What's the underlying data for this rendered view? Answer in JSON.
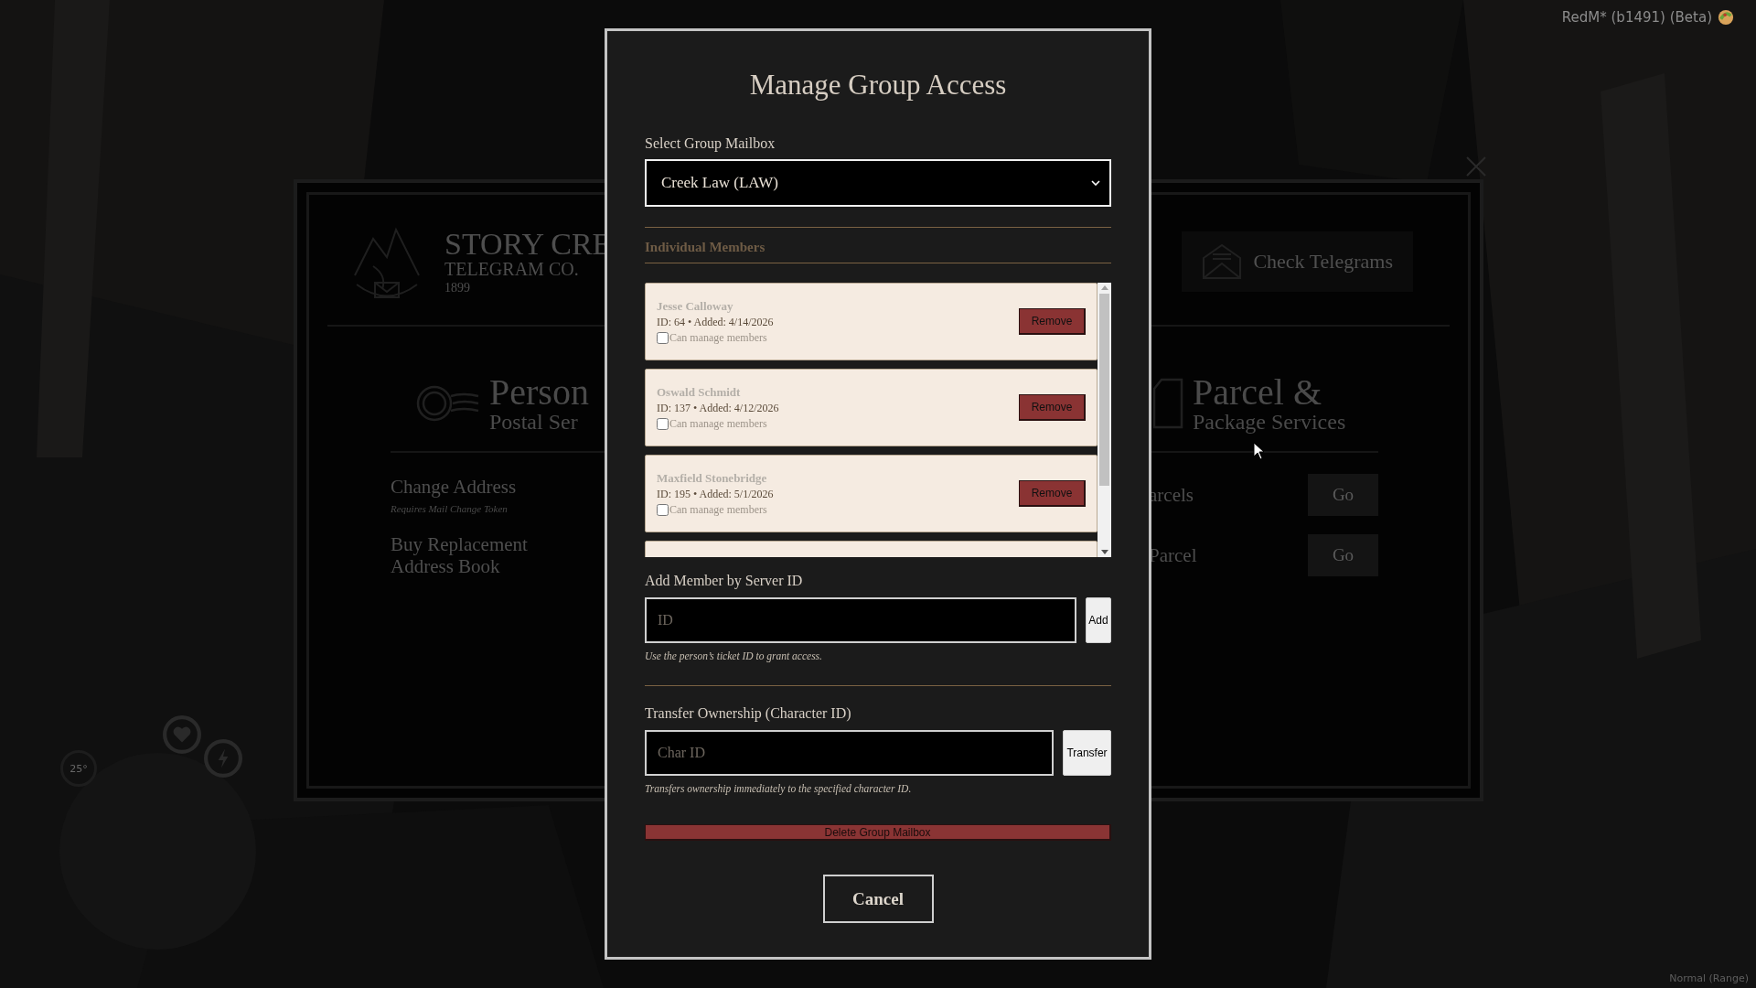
{
  "hud": {
    "build_label": "RedM* (b1491) (Beta)",
    "temperature": "25°",
    "voice_mode": "Normal (Range)"
  },
  "background_panel": {
    "brand": {
      "name": "STORY CRE",
      "subtitle": "TELEGRAM CO.",
      "year": "1899"
    },
    "check_button": "Check Telegrams",
    "sections": [
      {
        "kind": "postal",
        "title": "Person",
        "subtitle": "Postal Ser",
        "actions": [
          {
            "label": "Change Address",
            "note": "Requires Mail Change Token"
          },
          {
            "label": "Buy Replacement Address Book"
          }
        ]
      },
      {
        "kind": "parcel",
        "title": "Parcel &",
        "subtitle": "Package Services",
        "actions": [
          {
            "label": "arcels",
            "button": "Go"
          },
          {
            "label": "Parcel",
            "button": "Go"
          }
        ]
      }
    ]
  },
  "dialog": {
    "title": "Manage Group Access",
    "mailbox_label": "Select Group Mailbox",
    "mailbox_value": "Creek Law (LAW)",
    "members_heading": "Individual Members",
    "members": [
      {
        "name": "Jesse Calloway",
        "details": "ID: 64 • Added: 4/14/2026",
        "permission_label": "Can manage members",
        "checked": false,
        "remove_label": "Remove"
      },
      {
        "name": "Oswald Schmidt",
        "details": "ID: 137 • Added: 4/12/2026",
        "permission_label": "Can manage members",
        "checked": false,
        "remove_label": "Remove"
      },
      {
        "name": "Maxfield Stonebridge",
        "details": "ID: 195 • Added: 5/1/2026",
        "permission_label": "Can manage members",
        "checked": false,
        "remove_label": "Remove"
      }
    ],
    "add_label": "Add Member by Server ID",
    "id_placeholder": "ID",
    "add_button": "Add",
    "add_hint": "Use the person’s ticket ID to grant access.",
    "transfer_label": "Transfer Ownership (Character ID)",
    "char_placeholder": "Char ID",
    "transfer_button": "Transfer",
    "transfer_hint": "Transfers ownership immediately to the specified character ID.",
    "delete_button": "Delete Group Mailbox",
    "cancel_button": "Cancel"
  }
}
